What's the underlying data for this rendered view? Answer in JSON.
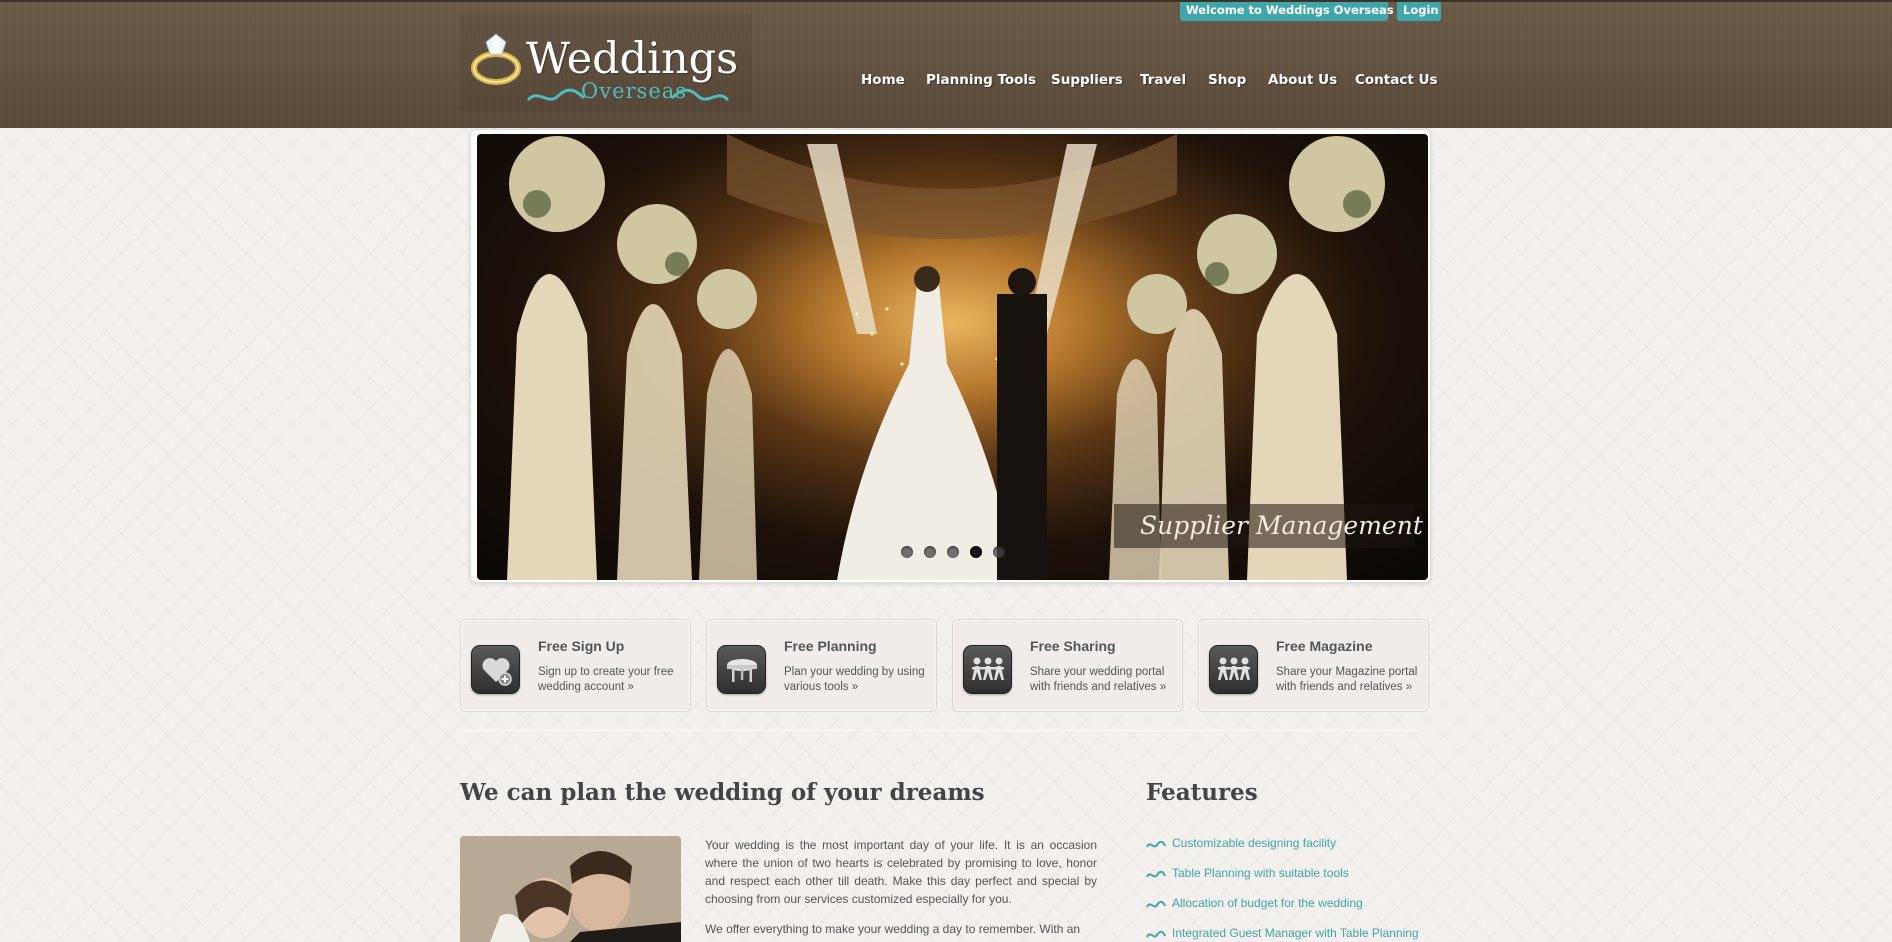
{
  "header": {
    "logo": {
      "title": "Weddings",
      "subtitle": "Overseas"
    },
    "welcome": "Welcome to Weddings Overseas",
    "login": "Login",
    "nav": [
      "Home",
      "Planning Tools",
      "Suppliers",
      "Travel",
      "Shop",
      "About Us",
      "Contact Us"
    ]
  },
  "slider": {
    "caption": "Supplier Management",
    "slides_count": 5,
    "active_slide": 4
  },
  "features_boxes": [
    {
      "title": "Free Sign Up",
      "desc": "Sign up to create your free wedding account »",
      "icon": "heart-add-icon"
    },
    {
      "title": "Free Planning",
      "desc": "Plan your wedding by using various tools »",
      "icon": "table-icon"
    },
    {
      "title": "Free Sharing",
      "desc": "Share your wedding portal with friends and relatives »",
      "icon": "people-icon"
    },
    {
      "title": "Free Magazine",
      "desc": "Share your Magazine portal with friends and relatives »",
      "icon": "people-icon"
    }
  ],
  "main": {
    "heading": "We can plan the wedding of your dreams",
    "paragraphs": [
      "Your wedding is the most important day of your life. It is an occasion where the union of two hearts is celebrated by promising to love, honor and respect each other till death. Make this day perfect and special by choosing from our services customized especially for you.",
      "We offer everything to make your wedding a day to remember. With an"
    ]
  },
  "sidebar": {
    "heading": "Features",
    "items": [
      "Customizable designing facility",
      "Table Planning with suitable tools",
      "Allocation of budget for the wedding",
      "Integrated Guest Manager with Table Planning"
    ]
  },
  "colors": {
    "header_bg": "#5f4e3d",
    "accent": "#3fa6a9",
    "text": "#555555"
  }
}
